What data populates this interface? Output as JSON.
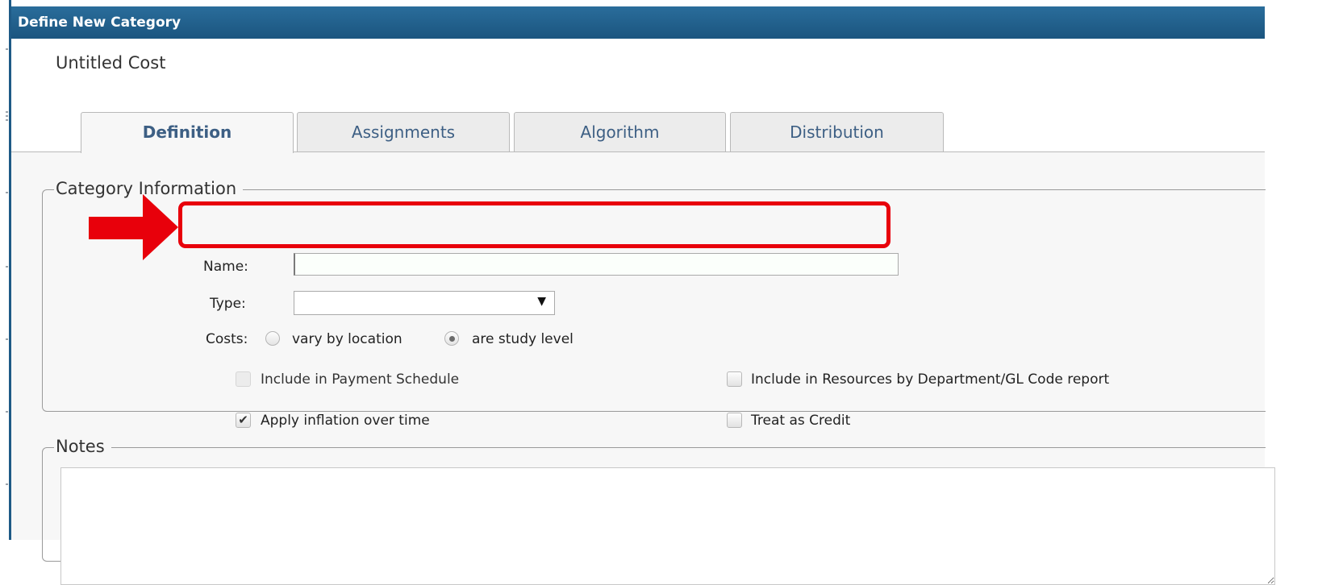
{
  "dialog": {
    "title": "Define New Category",
    "record_title": "Untitled Cost"
  },
  "tabs": [
    {
      "label": "Definition",
      "active": true
    },
    {
      "label": "Assignments",
      "active": false
    },
    {
      "label": "Algorithm",
      "active": false
    },
    {
      "label": "Distribution",
      "active": false
    }
  ],
  "category_info": {
    "legend": "Category Information",
    "name_label": "Name:",
    "name_value": "",
    "type_label": "Type:",
    "type_value": "",
    "costs_label": "Costs:",
    "costs_options": [
      {
        "label": "vary by location",
        "selected": false
      },
      {
        "label": "are study level",
        "selected": true
      }
    ],
    "checkboxes": {
      "payment_schedule": {
        "label": "Include in Payment Schedule",
        "checked": false,
        "disabled": true
      },
      "inflation": {
        "label": "Apply inflation over time",
        "checked": true,
        "disabled": false
      },
      "resources_report": {
        "label": "Include in Resources by Department/GL Code report",
        "checked": false,
        "disabled": false
      },
      "credit": {
        "label": "Treat as Credit",
        "checked": false,
        "disabled": false
      }
    }
  },
  "notes": {
    "legend": "Notes",
    "value": ""
  },
  "annotation": {
    "highlight_color": "#e8000b"
  },
  "colors": {
    "title_bar": "#1b557f",
    "tab_text": "#3d5f84",
    "content_bg": "#f7f7f7"
  }
}
